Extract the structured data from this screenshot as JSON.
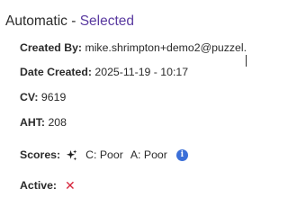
{
  "header": {
    "title": "Automatic",
    "separator": " - ",
    "status": "Selected"
  },
  "details": {
    "created_by_label": "Created By:",
    "created_by_value": "mike.shrimpton+demo2@puzzel.",
    "date_created_label": "Date Created:",
    "date_created_value": "2025-11-19 - 10:17",
    "cv_label": "CV:",
    "cv_value": "9619",
    "aht_label": "AHT:",
    "aht_value": "208",
    "scores_label": "Scores:",
    "score_c": "C: Poor",
    "score_a": "A: Poor",
    "active_label": "Active:"
  },
  "icons": {
    "scores_icon": "sparkle-icon",
    "info_icon": "info-icon",
    "active_icon": "x-icon"
  },
  "colors": {
    "status": "#5a3aa0",
    "info": "#3b6fd8",
    "inactive": "#d7263d"
  }
}
